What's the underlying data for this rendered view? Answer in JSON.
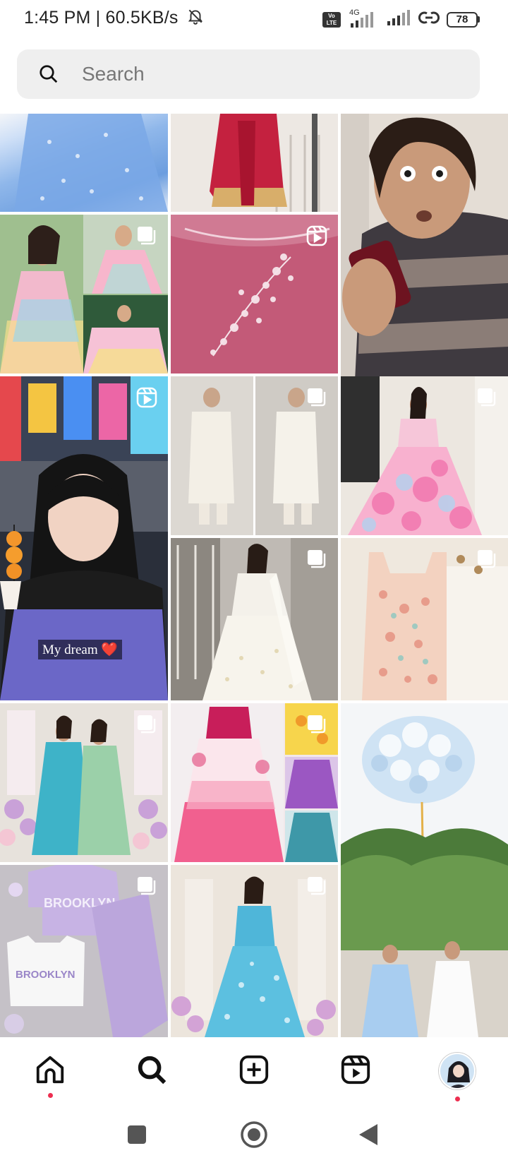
{
  "status": {
    "time_speed": "1:45 PM | 60.5KB/s",
    "network_type": "4G",
    "volte": "Vo LTE",
    "battery": "78"
  },
  "search": {
    "placeholder": "Search"
  },
  "grid": {
    "caption": "My dream ❤️",
    "tiles": [
      {
        "subject": "blue floral lehenga skirt",
        "badge": "none"
      },
      {
        "subject": "red sharara suit",
        "badge": "none"
      },
      {
        "subject": "boy surprised looking at phone",
        "badge": "none"
      },
      {
        "subject": "pastel tie-dye gown collage",
        "badge": "carousel-icon"
      },
      {
        "subject": "pink embroidered blouse",
        "badge": "reels-icon"
      },
      {
        "subject": "girl with skewer video",
        "badge": "reels-icon"
      },
      {
        "subject": "white anarkali suit",
        "badge": "carousel-icon"
      },
      {
        "subject": "pink floral lehenga",
        "badge": "carousel-icon"
      },
      {
        "subject": "white embroidered anarkali",
        "badge": "carousel-icon"
      },
      {
        "subject": "peach embroidered kurta",
        "badge": "carousel-icon"
      },
      {
        "subject": "two women in blue and green suits",
        "badge": "carousel-icon"
      },
      {
        "subject": "pink ombre lehenga collage",
        "badge": "carousel-icon"
      },
      {
        "subject": "pastel balloon and two girls",
        "badge": "none"
      },
      {
        "subject": "lavender Brooklyn co-ord set",
        "badge": "carousel-icon"
      },
      {
        "subject": "blue floral gown",
        "badge": "carousel-icon"
      }
    ]
  },
  "nav": {
    "items": [
      "home-icon",
      "search-icon",
      "create-icon",
      "reels-icon",
      "profile-avatar"
    ]
  },
  "system_nav": {
    "items": [
      "recents-square",
      "home-circle",
      "back-triangle"
    ]
  }
}
